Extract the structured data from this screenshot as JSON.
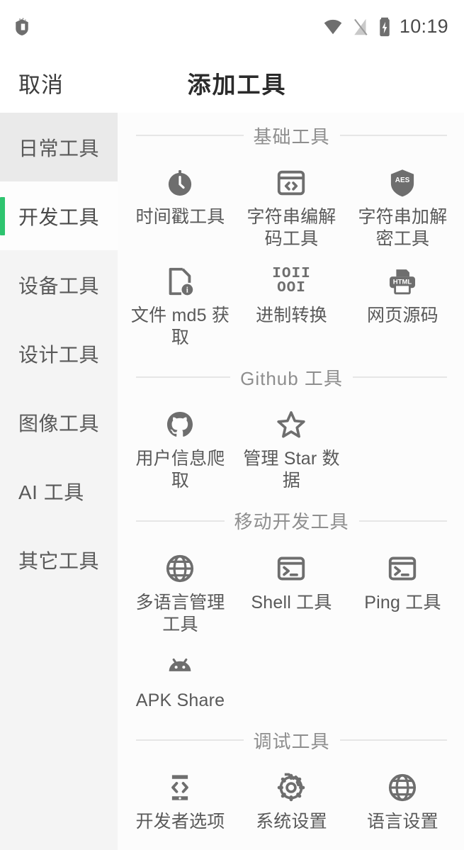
{
  "statusbar": {
    "time": "10:19",
    "icons": [
      "app-notification-icon",
      "wifi-icon",
      "signal-off-icon",
      "battery-charging-icon"
    ]
  },
  "titlebar": {
    "cancel_label": "取消",
    "title": "添加工具"
  },
  "sidebar": {
    "items": [
      {
        "label": "日常工具",
        "state": "dim"
      },
      {
        "label": "开发工具",
        "state": "active"
      },
      {
        "label": "设备工具",
        "state": "normal"
      },
      {
        "label": "设计工具",
        "state": "normal"
      },
      {
        "label": "图像工具",
        "state": "normal"
      },
      {
        "label": "AI 工具",
        "state": "normal"
      },
      {
        "label": "其它工具",
        "state": "normal"
      }
    ],
    "accent_color": "#2ec46f"
  },
  "sections": [
    {
      "title": "基础工具",
      "tools": [
        {
          "label": "时间戳工具",
          "icon": "clock-icon"
        },
        {
          "label": "字符串编解码工具",
          "icon": "code-brackets-icon"
        },
        {
          "label": "字符串加解密工具",
          "icon": "aes-shield-icon",
          "icon_text": "AES"
        },
        {
          "label": "文件 md5 获取",
          "icon": "file-info-icon"
        },
        {
          "label": "进制转换",
          "icon": "binary-icon",
          "icon_text": "1011 001"
        },
        {
          "label": "网页源码",
          "icon": "html-printer-icon",
          "icon_text": "HTML"
        }
      ]
    },
    {
      "title": "Github 工具",
      "tools": [
        {
          "label": "用户信息爬取",
          "icon": "github-icon"
        },
        {
          "label": "管理 Star 数据",
          "icon": "star-icon"
        }
      ]
    },
    {
      "title": "移动开发工具",
      "tools": [
        {
          "label": "多语言管理工具",
          "icon": "globe-icon"
        },
        {
          "label": "Shell 工具",
          "icon": "terminal-icon"
        },
        {
          "label": "Ping 工具",
          "icon": "terminal-icon"
        },
        {
          "label": "APK Share",
          "icon": "android-icon"
        }
      ]
    },
    {
      "title": "调试工具",
      "tools": [
        {
          "label": "开发者选项",
          "icon": "phone-code-icon"
        },
        {
          "label": "系统设置",
          "icon": "gear-icon"
        },
        {
          "label": "语言设置",
          "icon": "globe-icon"
        }
      ]
    }
  ]
}
